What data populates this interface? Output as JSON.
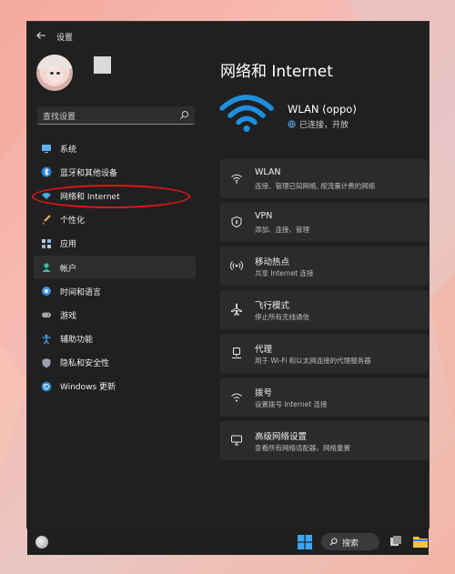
{
  "window": {
    "title": "设置"
  },
  "search": {
    "placeholder": "查找设置"
  },
  "sidebar": {
    "items": [
      {
        "label": "系统",
        "icon": "monitor-icon"
      },
      {
        "label": "蓝牙和其他设备",
        "icon": "bluetooth-icon"
      },
      {
        "label": "网络和 Internet",
        "icon": "wifi-diamond-icon"
      },
      {
        "label": "个性化",
        "icon": "brush-icon"
      },
      {
        "label": "应用",
        "icon": "apps-icon"
      },
      {
        "label": "帐户",
        "icon": "person-icon"
      },
      {
        "label": "时间和语言",
        "icon": "globe-clock-icon"
      },
      {
        "label": "游戏",
        "icon": "gamepad-icon"
      },
      {
        "label": "辅助功能",
        "icon": "accessibility-icon"
      },
      {
        "label": "隐私和安全性",
        "icon": "shield-icon"
      },
      {
        "label": "Windows 更新",
        "icon": "update-icon"
      }
    ]
  },
  "main": {
    "title": "网络和 Internet",
    "network": {
      "name": "WLAN (oppo)",
      "status": "已连接，开放"
    },
    "cards": [
      {
        "title": "WLAN",
        "subtitle": "连接、管理已知网络, 按流量计费的网络",
        "icon": "wifi-icon"
      },
      {
        "title": "VPN",
        "subtitle": "添加、连接、管理",
        "icon": "vpn-shield-icon"
      },
      {
        "title": "移动热点",
        "subtitle": "共享 Internet 连接",
        "icon": "hotspot-icon"
      },
      {
        "title": "飞行模式",
        "subtitle": "停止所有无线通信",
        "icon": "airplane-icon"
      },
      {
        "title": "代理",
        "subtitle": "用于 Wi-Fi 和以太网连接的代理服务器",
        "icon": "proxy-icon"
      },
      {
        "title": "拨号",
        "subtitle": "设置拨号 Internet 连接",
        "icon": "dialup-icon"
      },
      {
        "title": "高级网络设置",
        "subtitle": "查看所有网络适配器，网络重置",
        "icon": "advanced-network-icon"
      }
    ]
  },
  "taskbar": {
    "search_label": "搜索"
  },
  "colors": {
    "accent": "#4cc2ff",
    "wifi_blue": "#1e8fe0",
    "highlight_red": "#e0151b"
  }
}
